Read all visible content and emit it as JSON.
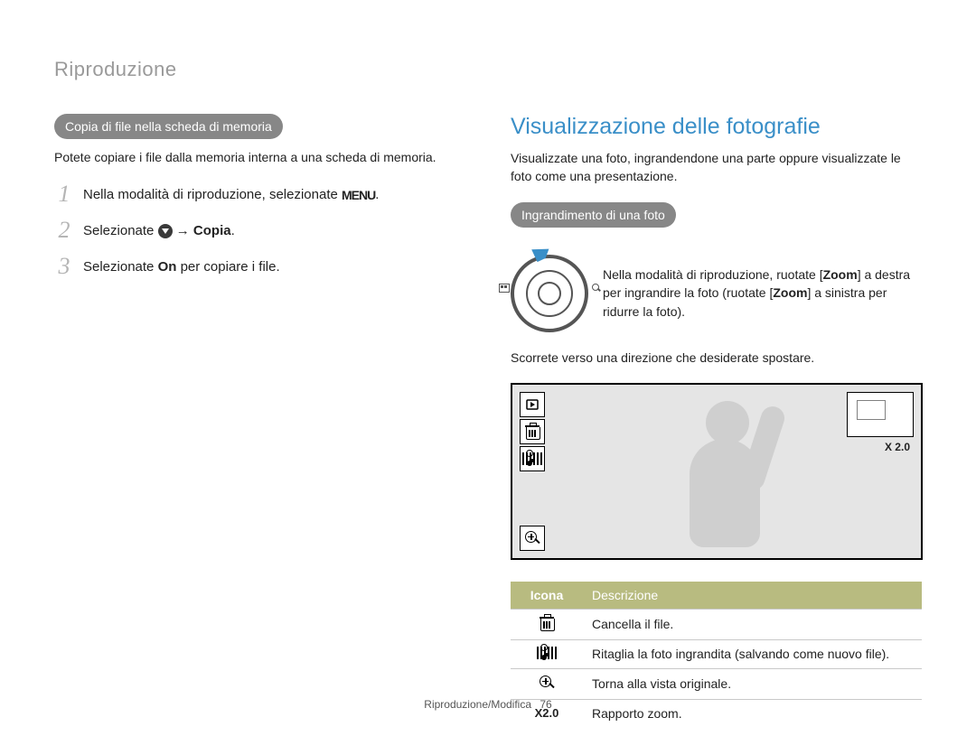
{
  "section_title": "Riproduzione",
  "left": {
    "pill": "Copia di file nella scheda di memoria",
    "intro": "Potete copiare i file dalla memoria interna a una scheda di memoria.",
    "steps": [
      {
        "num": "1",
        "pre": "Nella modalità di riproduzione, selezionate ",
        "icon": "menu",
        "post": "."
      },
      {
        "num": "2",
        "pre": "Selezionate ",
        "icon": "dropdown",
        "post": " → ",
        "bold": "Copia",
        "tail": "."
      },
      {
        "num": "3",
        "pre": "Selezionate ",
        "bold": "On",
        "tail": " per copiare i file."
      }
    ]
  },
  "right": {
    "heading": "Visualizzazione delle fotografie",
    "intro": "Visualizzate una foto, ingrandendone una parte oppure visualizzate le foto come una presentazione.",
    "pill": "Ingrandimento di una foto",
    "zoom_instruction": {
      "a": "Nella modalità di riproduzione, ruotate [",
      "b1": "Zoom",
      "c": "] a destra per ingrandire la foto (ruotate [",
      "b2": "Zoom",
      "d": "] a sinistra per ridurre la foto)."
    },
    "scroll_instruction": "Scorrete verso una direzione che desiderate spostare.",
    "screen": {
      "zoom_label": "X 2.0"
    },
    "table": {
      "header": {
        "c1": "Icona",
        "c2": "Descrizione"
      },
      "rows": [
        {
          "icon": "trash",
          "text": "Cancella il file."
        },
        {
          "icon": "crop",
          "text": "Ritaglia la foto ingrandita (salvando come nuovo file)."
        },
        {
          "icon": "zoom",
          "text": "Torna alla vista originale."
        },
        {
          "icon": "text",
          "icon_text": "X2.0",
          "text": "Rapporto zoom."
        }
      ]
    }
  },
  "footer": {
    "path": "Riproduzione/Modifica",
    "page": "76"
  }
}
